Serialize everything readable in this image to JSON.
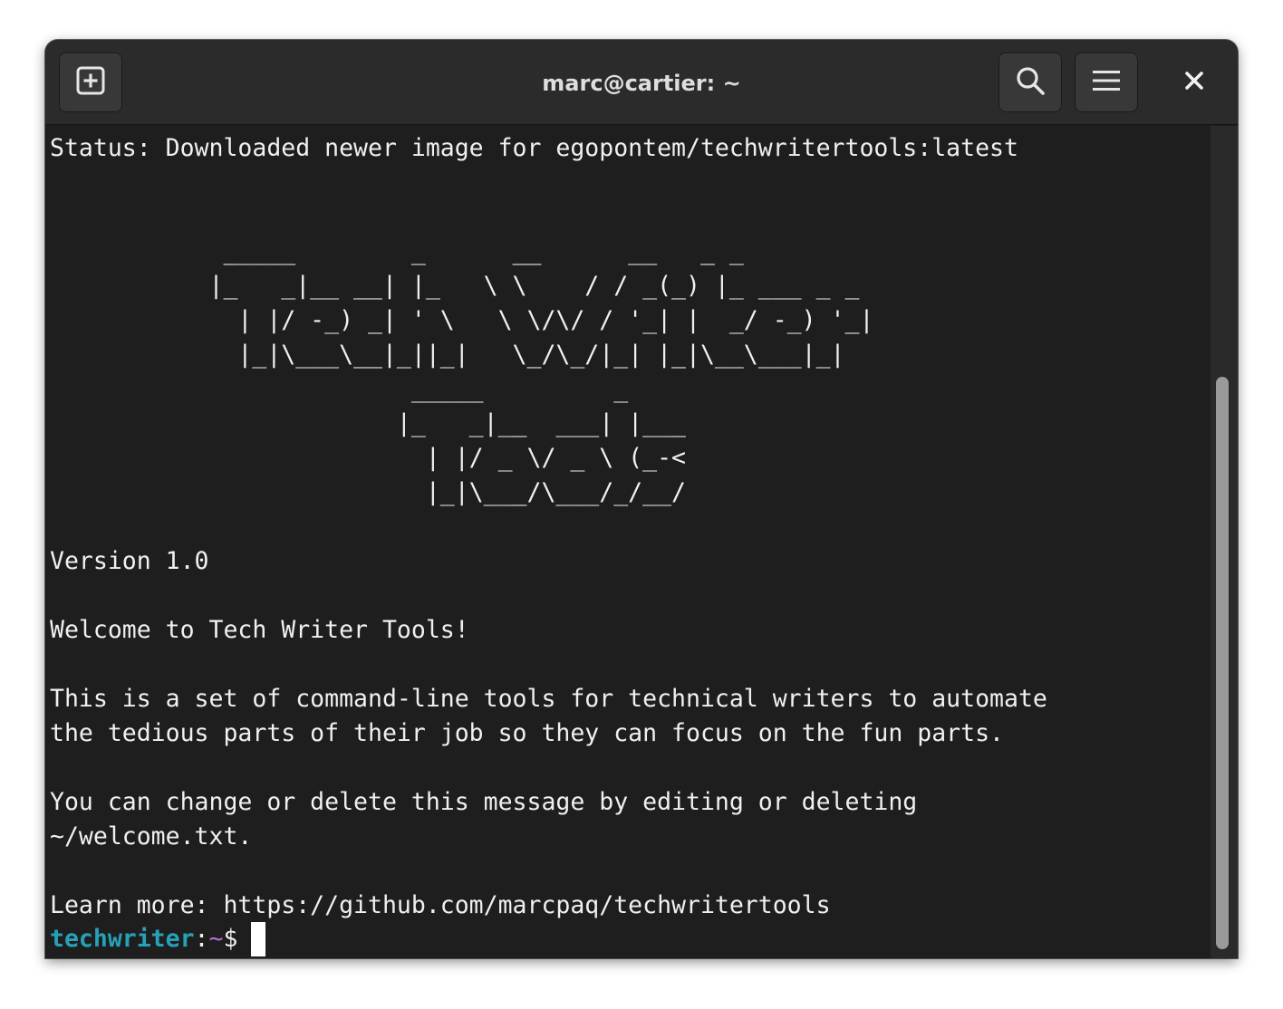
{
  "window": {
    "title": "marc@cartier: ~"
  },
  "titlebar": {
    "new_tab_icon": "new-tab-plus-icon",
    "search_icon": "search-icon",
    "menu_icon": "hamburger-menu-icon",
    "close_icon": "close-icon"
  },
  "terminal": {
    "status_line": "Status: Downloaded newer image for egopontem/techwritertools:latest",
    "banner": [
      "",
      "",
      "            _____        _      __      __   _ _",
      "           |_   _|__ __| |_   \\ \\    / / _(_) |_ ___ _ _",
      "             | |/ -_) _| ' \\   \\ \\/\\/ / '_| |  _/ -_) '_|",
      "             |_|\\___\\__|_||_|   \\_/\\_/|_| |_|\\__\\___|_|",
      "                         _____         _",
      "                        |_   _|__  ___| |___",
      "                          | |/ _ \\/ _ \\ (_-<",
      "                          |_|\\___/\\___/_/__/",
      ""
    ],
    "version": "Version 1.0",
    "welcome": "Welcome to Tech Writer Tools!",
    "description_1": "This is a set of command-line tools for technical writers to automate",
    "description_2": "the tedious parts of their job so they can focus on the fun parts.",
    "change_msg_1": "You can change or delete this message by editing or deleting",
    "change_msg_2": "~/welcome.txt.",
    "learn_more": "Learn more: https://github.com/marcpaq/techwritertools",
    "prompt": {
      "user": "techwriter",
      "colon": ":",
      "dir": "~",
      "symbol": "$"
    }
  },
  "colors": {
    "terminal_bg": "#1e1e1e",
    "titlebar_bg": "#2b2b2b",
    "text": "#f0f0f0",
    "prompt_user": "#26a1b8",
    "prompt_dir": "#b36fd1"
  }
}
